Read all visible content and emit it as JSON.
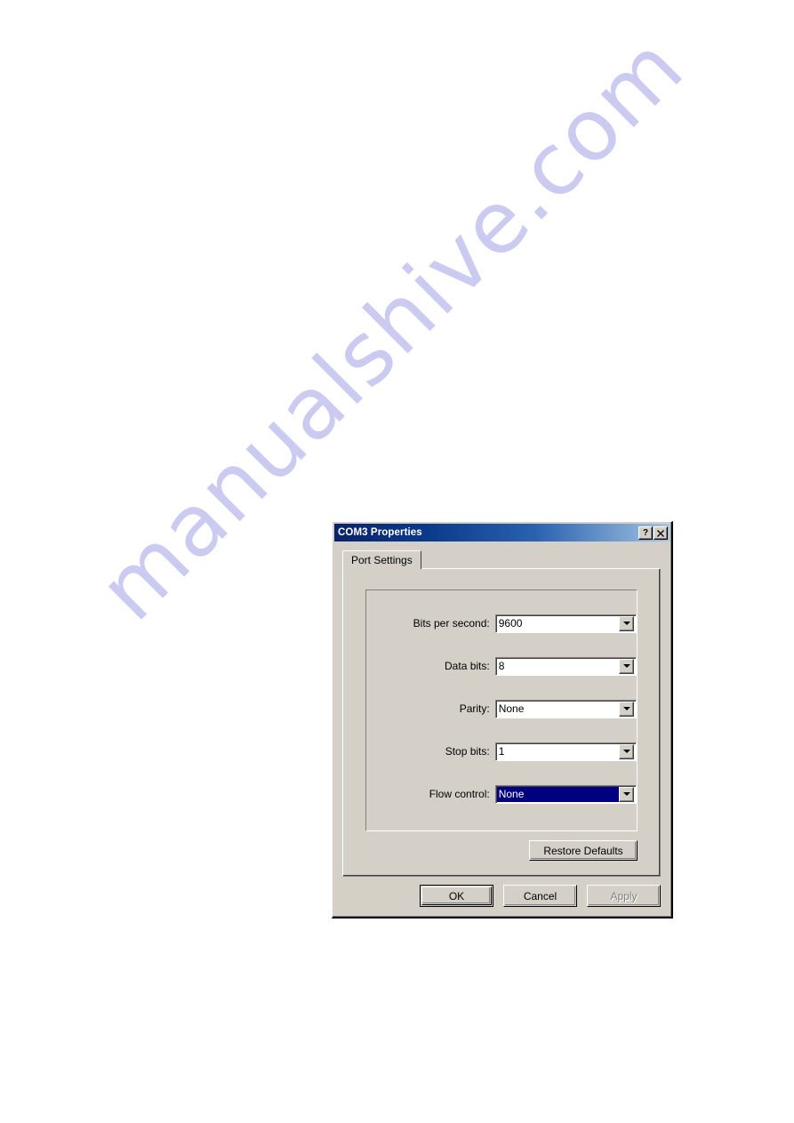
{
  "page": {
    "watermark_text": "manualshive.com",
    "watermark_color": "#c9c9f2",
    "background_color": "#ffffff"
  },
  "dialog": {
    "title": "COM3 Properties",
    "titlebar": {
      "help_button_label": "?",
      "help_button_icon": "question-mark-icon",
      "close_button_label": "✕",
      "close_button_icon": "close-x-icon",
      "gradient_start": "#0a246a",
      "gradient_end": "#a8c4e0"
    },
    "tabs": [
      {
        "label": "Port Settings",
        "selected": true
      }
    ],
    "fields": [
      {
        "id": "bits-per-second",
        "label": "Bits per second:",
        "value": "9600",
        "focused": false,
        "dropdown_icon": "chevron-down-icon"
      },
      {
        "id": "data-bits",
        "label": "Data bits:",
        "value": "8",
        "focused": false,
        "dropdown_icon": "chevron-down-icon"
      },
      {
        "id": "parity",
        "label": "Parity:",
        "value": "None",
        "focused": false,
        "dropdown_icon": "chevron-down-icon"
      },
      {
        "id": "stop-bits",
        "label": "Stop bits:",
        "value": "1",
        "focused": false,
        "dropdown_icon": "chevron-down-icon"
      },
      {
        "id": "flow-control",
        "label": "Flow control:",
        "value": "None",
        "focused": true,
        "dropdown_icon": "chevron-down-icon"
      }
    ],
    "restore_defaults_label": "Restore Defaults",
    "buttons": {
      "ok_label": "OK",
      "cancel_label": "Cancel",
      "apply_label": "Apply",
      "apply_disabled": true
    },
    "colors": {
      "face": "#d4d0c8",
      "field_background": "#ffffff",
      "selection": "#000080",
      "selection_text": "#ffffff",
      "disabled_text": "#808080"
    }
  }
}
